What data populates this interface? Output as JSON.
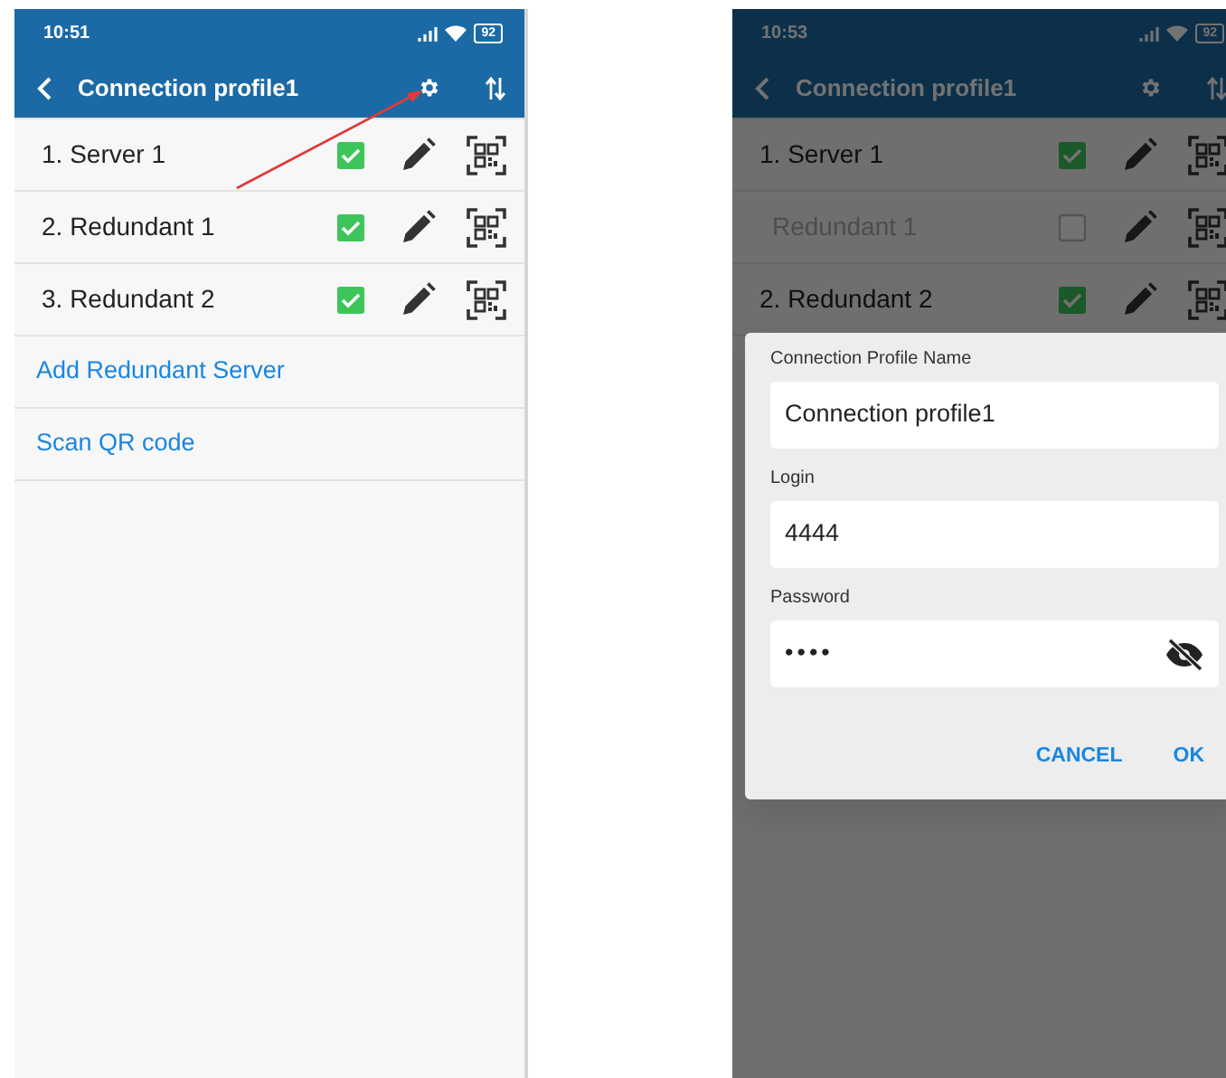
{
  "screens": [
    {
      "status_bar": {
        "time": "10:51",
        "battery": "92"
      },
      "app_bar": {
        "title": "Connection profile1"
      },
      "dimmed": false,
      "pointer_arrow": true,
      "servers": [
        {
          "label": "1. Server 1",
          "checked": true,
          "disabled": false
        },
        {
          "label": "2. Redundant 1",
          "checked": true,
          "disabled": false
        },
        {
          "label": "3. Redundant 2",
          "checked": true,
          "disabled": false
        }
      ],
      "links": [
        "Add Redundant Server",
        "Scan QR code"
      ]
    },
    {
      "status_bar": {
        "time": "10:53",
        "battery": "92"
      },
      "app_bar": {
        "title": "Connection profile1"
      },
      "dimmed": true,
      "pointer_arrow": false,
      "servers": [
        {
          "label": "1. Server 1",
          "checked": true,
          "disabled": false
        },
        {
          "label": "Redundant 1",
          "checked": false,
          "disabled": true
        },
        {
          "label": "2. Redundant 2",
          "checked": true,
          "disabled": false
        }
      ],
      "dialog": {
        "fields": [
          {
            "kind": "text",
            "label": "Connection Profile Name",
            "value": "Connection profile1"
          },
          {
            "kind": "text",
            "label": "Login",
            "value": "4444"
          },
          {
            "kind": "password",
            "label": "Password",
            "value": "••••"
          }
        ],
        "buttons": [
          "CANCEL",
          "OK"
        ]
      }
    }
  ]
}
